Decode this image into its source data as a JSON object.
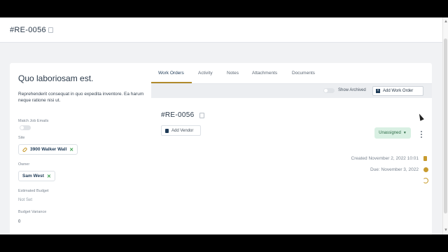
{
  "header": {
    "ref": "#RE-0056"
  },
  "left": {
    "title": "Quo laboriosam est.",
    "description": "Reprehenderit consequat in quo expedita inventore. Ea harum neque ratione nisi ut.",
    "match_job_emails_label": "Match Job Emails",
    "site_label": "Site",
    "site_value": "3900 Walker Wall",
    "owner_label": "Owner",
    "owner_value": "Sam West",
    "estimated_budget_label": "Estimated Budget",
    "estimated_budget_value": "Not Set",
    "budget_variance_label": "Budget Variance",
    "budget_variance_value": "0"
  },
  "tabs": [
    "Work Orders",
    "Activity",
    "Notes",
    "Attachments",
    "Documents"
  ],
  "toolbar": {
    "show_archived": "Show Archived",
    "add_work_order": "Add Work Order"
  },
  "work_order": {
    "ref": "#RE-0056",
    "add_vendor": "Add Vendor",
    "status": "Unassigned",
    "created": "Created November 2, 2022 10:01",
    "due": "Due: November 3, 2022"
  }
}
